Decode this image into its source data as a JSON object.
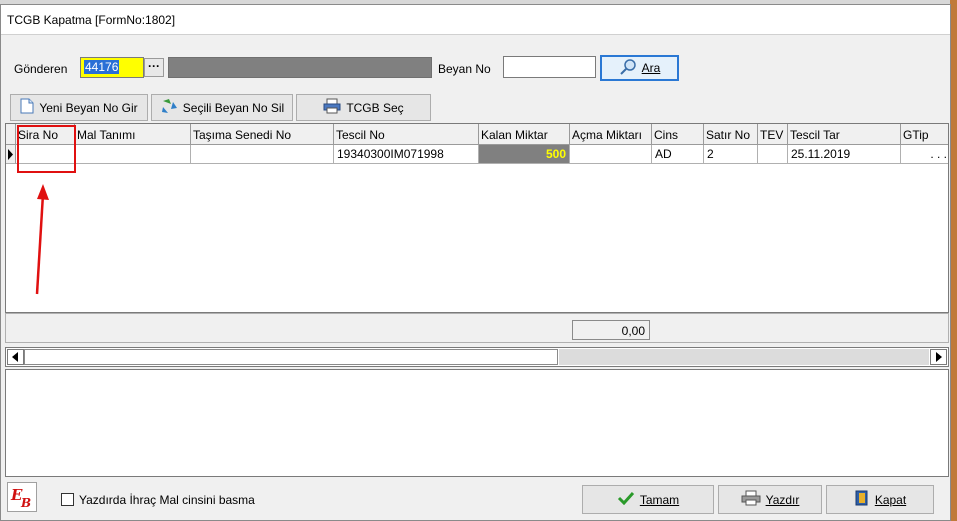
{
  "window": {
    "title": "TCGB Kapatma [FormNo:1802]"
  },
  "sender": {
    "label": "Gönderen",
    "value": "44176",
    "lookup_label": "···"
  },
  "beyan": {
    "label": "Beyan No",
    "value": ""
  },
  "search_button": {
    "label": "Ara"
  },
  "toolbar": {
    "new_label": "Yeni Beyan No Gir",
    "delete_label": "Seçili Beyan No Sil",
    "select_label": "TCGB Seç"
  },
  "grid": {
    "columns": [
      "Sira No",
      "Mal Tanımı",
      "Taşıma Senedi No",
      "Tescil No",
      "Kalan Miktar",
      "Açma Miktarı",
      "Cins",
      "Satır No",
      "TEV",
      "Tescil Tar",
      "GTip"
    ],
    "row": [
      "",
      "",
      "",
      "19340300IM071998",
      "500",
      "",
      "AD",
      "2",
      "",
      "25.11.2019",
      ". . ."
    ],
    "total": "0,00"
  },
  "footer": {
    "checkbox_label": "Yazdırda İhraç Mal cinsini basma",
    "ok_label": "Tamam",
    "print_label": "Yazdır",
    "close_label": "Kapat"
  },
  "colors": {
    "highlight": "#ffff00",
    "selection": "#2a6fd6",
    "annotation": "#e01010",
    "focus": "#2a78d4"
  }
}
